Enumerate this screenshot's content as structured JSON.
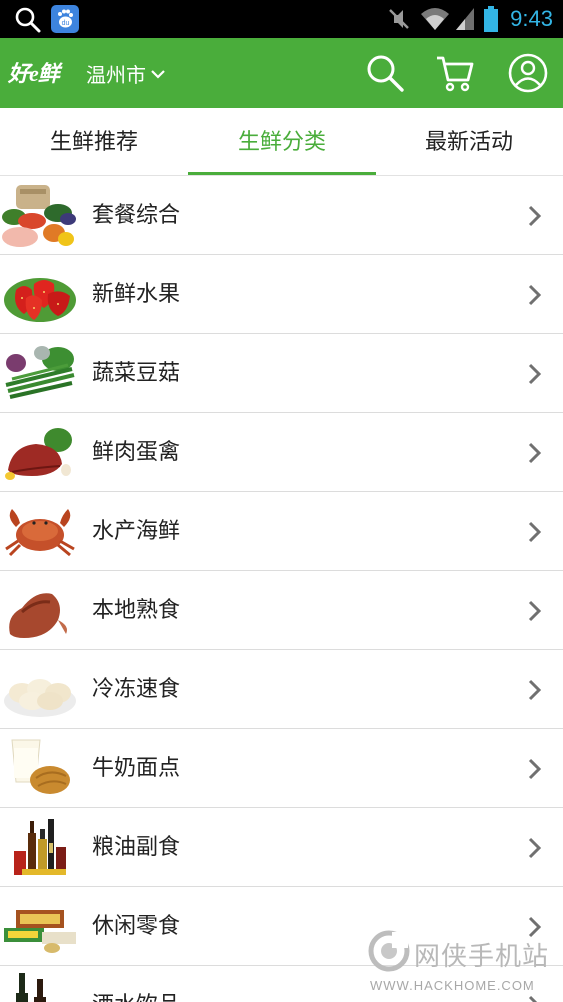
{
  "status_bar": {
    "time": "9:43",
    "time_color": "#33b5e5",
    "icons": [
      "search-icon",
      "baidu-app-icon",
      "mute-icon",
      "wifi-icon",
      "signal-icon",
      "battery-icon"
    ]
  },
  "header": {
    "logo": "好e鲜",
    "city": "温州市",
    "brand_color": "#4aad3b",
    "icons": [
      "search-icon",
      "cart-icon",
      "user-icon"
    ]
  },
  "tabs": [
    {
      "label": "生鲜推荐",
      "active": false
    },
    {
      "label": "生鲜分类",
      "active": true
    },
    {
      "label": "最新活动",
      "active": false
    }
  ],
  "categories": [
    {
      "label": "套餐综合",
      "icon": "combo-produce-thumbnail"
    },
    {
      "label": "新鲜水果",
      "icon": "strawberry-thumbnail"
    },
    {
      "label": "蔬菜豆菇",
      "icon": "vegetables-thumbnail"
    },
    {
      "label": "鲜肉蛋禽",
      "icon": "meat-thumbnail"
    },
    {
      "label": "水产海鲜",
      "icon": "crab-thumbnail"
    },
    {
      "label": "本地熟食",
      "icon": "cooked-meat-thumbnail"
    },
    {
      "label": "冷冻速食",
      "icon": "dumplings-thumbnail"
    },
    {
      "label": "牛奶面点",
      "icon": "milk-bread-thumbnail"
    },
    {
      "label": "粮油副食",
      "icon": "oil-sauce-bottles-thumbnail"
    },
    {
      "label": "休闲零食",
      "icon": "snack-boxes-thumbnail"
    },
    {
      "label": "酒水饮品",
      "icon": "wine-bottles-thumbnail"
    }
  ],
  "watermark": {
    "title": "网侠手机站",
    "url": "WWW.HACKHOME.COM"
  }
}
